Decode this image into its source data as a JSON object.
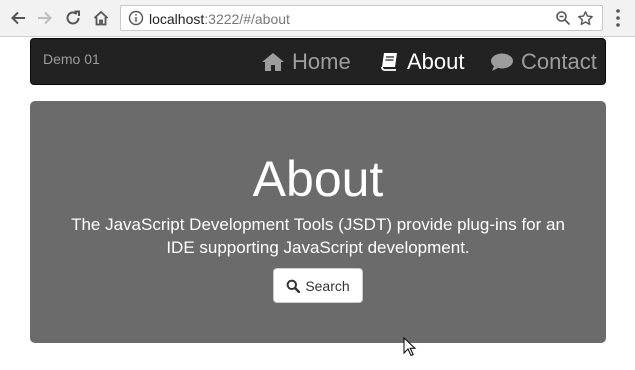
{
  "browser": {
    "url_host": "localhost",
    "url_rest": ":3222/#/about",
    "icons": {
      "back": "back-arrow-icon",
      "forward": "forward-arrow-icon",
      "reload": "reload-icon",
      "home": "home-icon",
      "info": "info-icon",
      "zoom": "zoom-icon",
      "bookmark": "star-icon",
      "menu": "kebab-menu-icon"
    }
  },
  "navbar": {
    "brand": "Demo 01",
    "items": [
      {
        "label": "Home",
        "icon": "home-icon",
        "active": false
      },
      {
        "label": "About",
        "icon": "book-icon",
        "active": true
      },
      {
        "label": "Contact",
        "icon": "comment-icon",
        "active": false
      }
    ]
  },
  "jumbotron": {
    "title": "About",
    "lead": "The JavaScript Development Tools (JSDT) provide plug-ins for an IDE supporting JavaScript development.",
    "button_label": "Search",
    "button_icon": "search-icon"
  },
  "colors": {
    "navbar_bg": "#222222",
    "navbar_text": "#9d9d9d",
    "navbar_active_text": "#ffffff",
    "jumbotron_bg": "#6b6b6b"
  }
}
